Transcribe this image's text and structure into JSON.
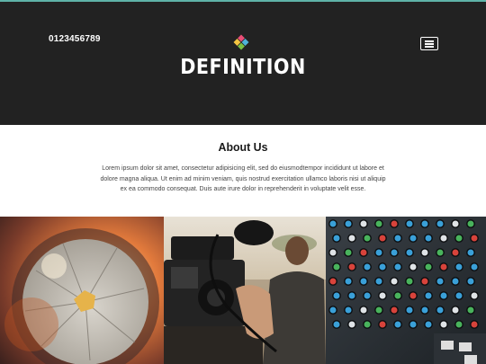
{
  "header": {
    "phone": "0123456789",
    "brand": "DEFINITION",
    "logo_icon": "diamond-grid-logo",
    "menu_icon": "hamburger-menu-icon",
    "colors": {
      "background": "#222222",
      "accent_line": "#5fb3a8",
      "logo": [
        "#e94e77",
        "#4fb3d9",
        "#f5c542",
        "#7bc043"
      ]
    }
  },
  "about": {
    "title": "About Us",
    "text": "Lorem ipsum dolor sit amet, consectetur adipisicing elit, sed do eiusmodtempor incididunt ut labore et dolore magna aliqua. Ut enim ad minim veniam, quis nostrud exercitation ullamco laboris nisi ut aliquip ex ea commodo consequat. Duis aute irure dolor in reprehenderit in voluptate velit esse."
  },
  "gallery": {
    "items": [
      {
        "subject": "camera lens aperture"
      },
      {
        "subject": "videographer with camera"
      },
      {
        "subject": "audio mixing console"
      }
    ]
  }
}
